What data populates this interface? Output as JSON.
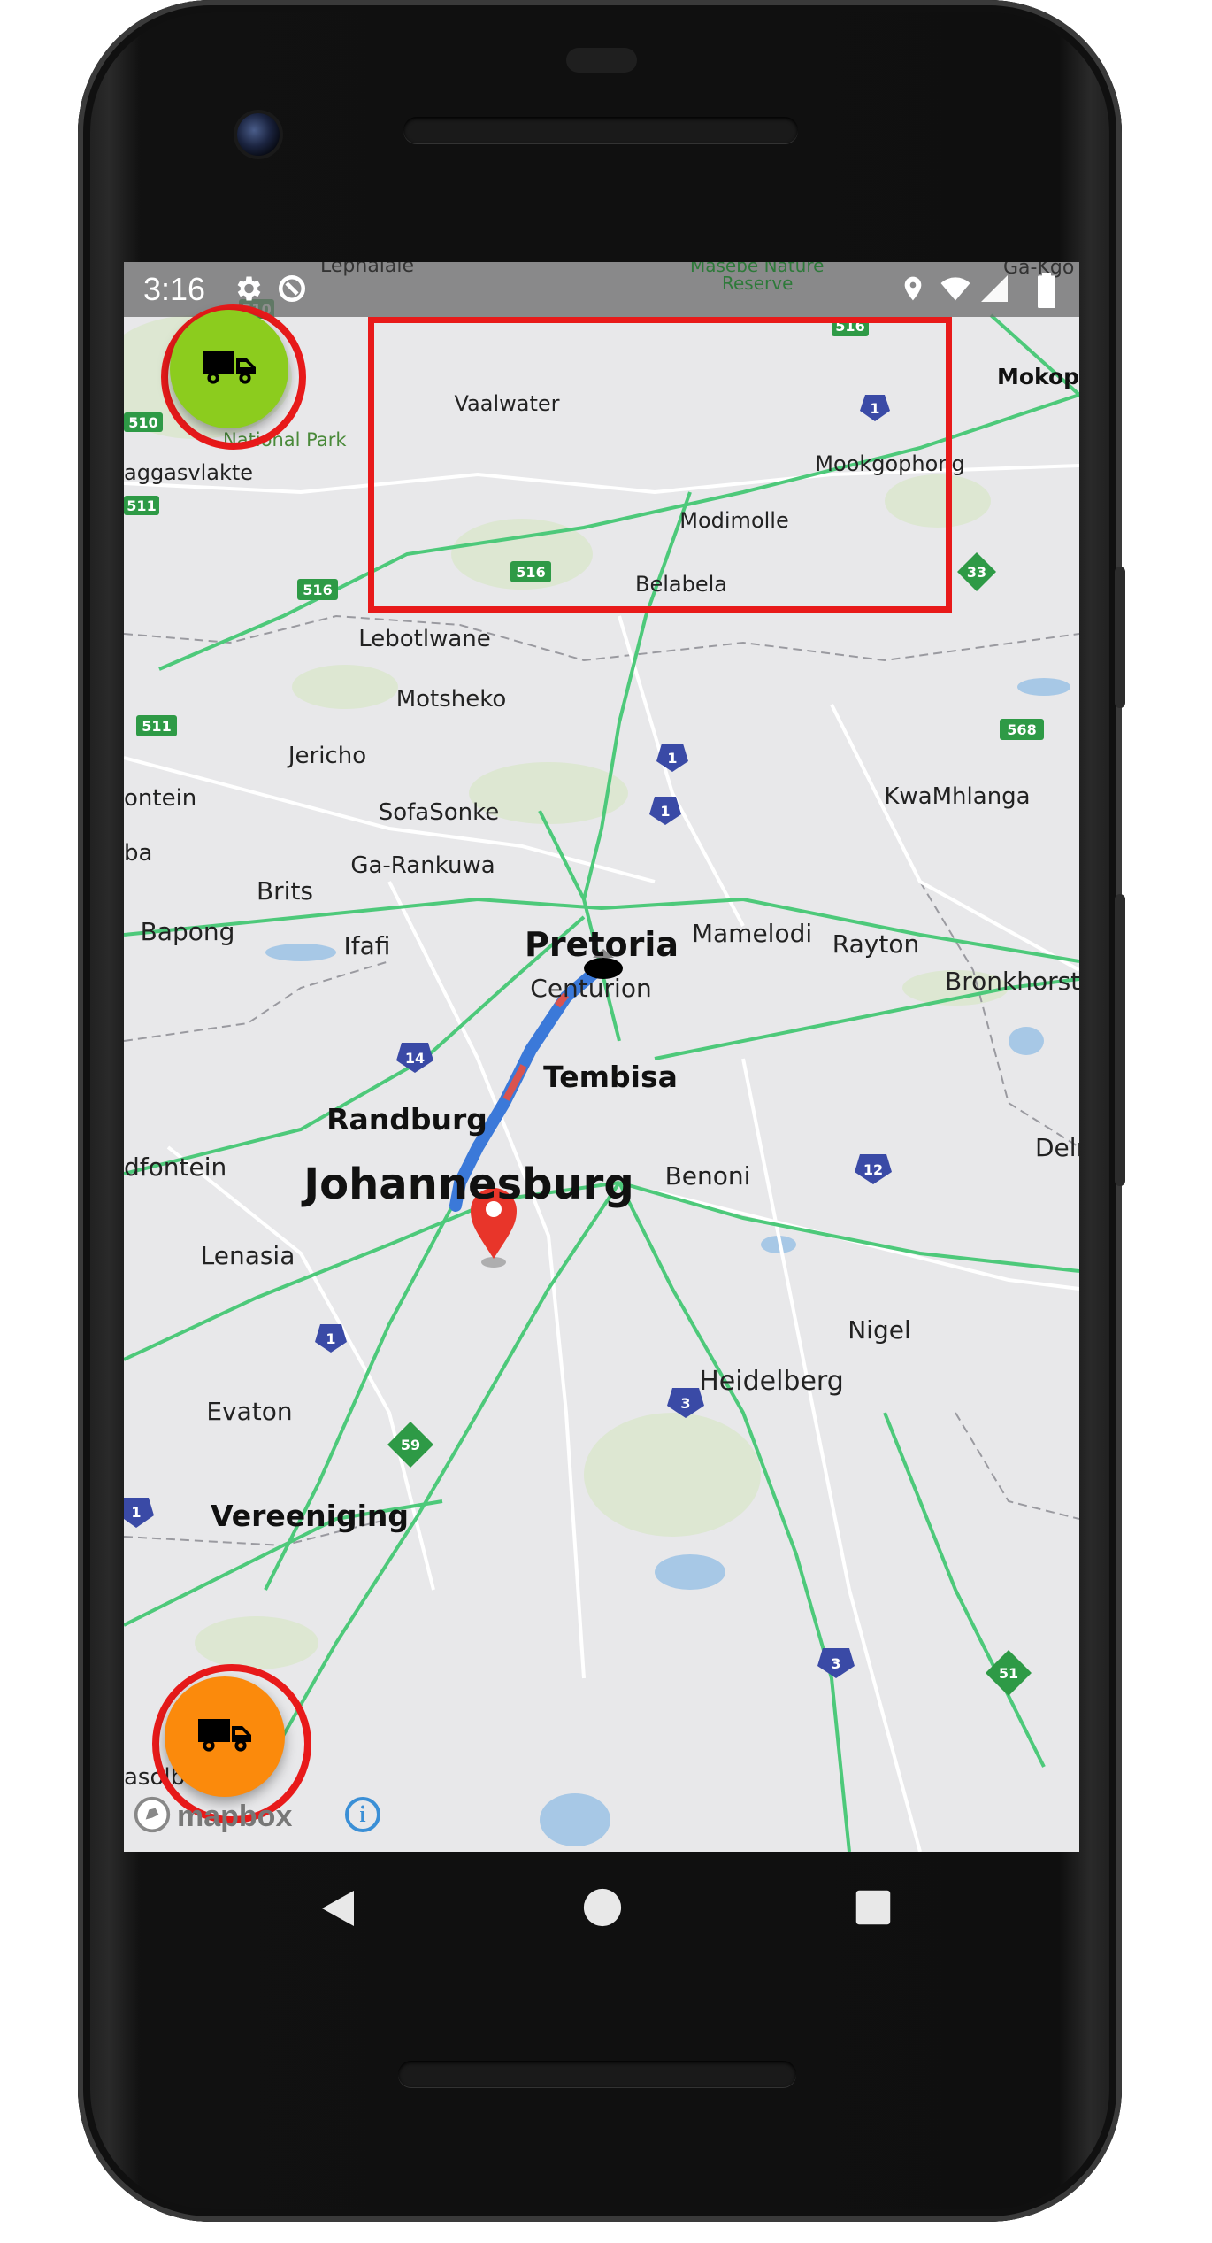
{
  "status_bar": {
    "time": "3:16",
    "icons": [
      "gear-icon",
      "data-saver-icon",
      "location-icon",
      "wifi-icon",
      "signal-icon",
      "battery-icon"
    ]
  },
  "map": {
    "labels": {
      "top_left_partial": "Lephalale",
      "top_mid_partial": "Masebe Nature",
      "top_mid_partial2": "Reserve",
      "top_right_partial": "Ga-Kgo",
      "mokopa": "Mokopa",
      "national_park": "National Park",
      "zaggasvlakte": "aggasvlakte",
      "vaalwater": "Vaalwater",
      "mookgophong": "Mookgophong",
      "modimolle": "Modimolle",
      "belabela": "Belabela",
      "lebotlwane": "Lebotlwane",
      "motsheko": "Motsheko",
      "jericho": "Jericho",
      "kwamhlanga": "KwaMhlanga",
      "sofasonke": "SofaSonke",
      "ga_rankuwa": "Ga-Rankuwa",
      "brits": "Brits",
      "bapong": "Bapong",
      "ifafi": "Ifafi",
      "pretoria": "Pretoria",
      "mamelodi": "Mamelodi",
      "rayton": "Rayton",
      "bronkhorst": "Bronkhorst",
      "centurion": "Centurion",
      "tembisa": "Tembisa",
      "randburg": "Randburg",
      "johannesburg": "Johannesburg",
      "benoni": "Benoni",
      "delmas": "Delma",
      "roodepoort": "dfontein",
      "lenasia": "Lenasia",
      "nigel": "Nigel",
      "heidelberg": "Heidelberg",
      "evaton": "Evaton",
      "vereeniging": "Vereeniging",
      "sasolburg": "asolb",
      "fontein": "ontein",
      "ba": "ba"
    },
    "road_shields": {
      "r510_a": "510",
      "r510_b": "510",
      "r511_a": "511",
      "r511_b": "511",
      "r516_a": "516",
      "r516_b": "516",
      "r516_top": "516",
      "r568": "568",
      "n1_a": "1",
      "n1_b": "1",
      "n1_c": "1",
      "n1_d": "1",
      "n1_e": "1",
      "n14": "14",
      "n12": "12",
      "n3_a": "3",
      "n3_b": "3",
      "r33": "33",
      "r59": "59",
      "r51": "51"
    },
    "attribution": "mapbox",
    "info_icon": "i"
  },
  "fabs": {
    "top": {
      "icon": "truck-icon",
      "color": "#8ccc1e"
    },
    "bottom": {
      "icon": "truck-icon",
      "color": "#fb8a0c"
    }
  },
  "annotation": {
    "highlight_color": "#e81a1a"
  },
  "nav_bar": {
    "icons": [
      "back-icon",
      "home-icon",
      "recents-icon"
    ]
  }
}
